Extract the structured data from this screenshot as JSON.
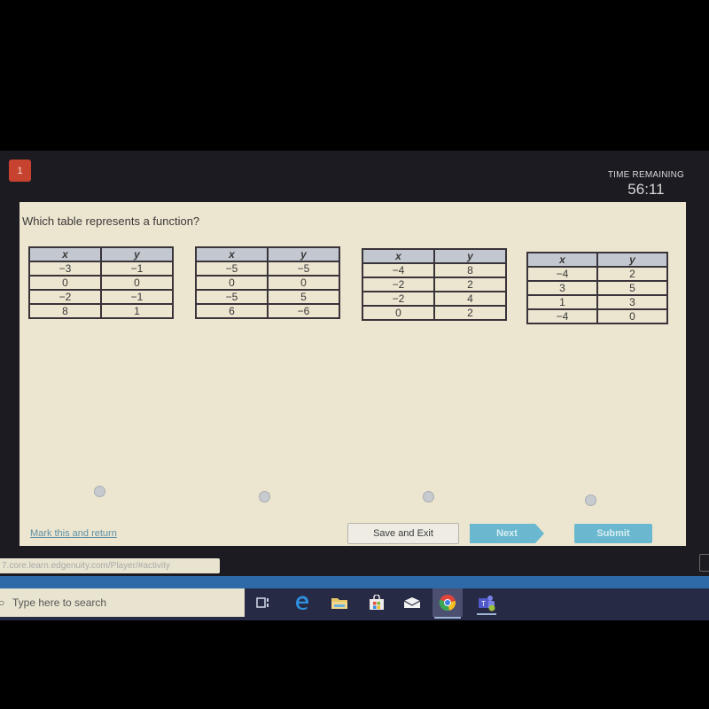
{
  "header": {
    "question_number": "1",
    "timer_label": "TIME REMAINING",
    "timer_value": "56:11"
  },
  "question": {
    "prompt": "Which table represents a function?",
    "options": [
      {
        "columns": [
          "x",
          "y"
        ],
        "rows": [
          [
            "−3",
            "−1"
          ],
          [
            "0",
            "0"
          ],
          [
            "−2",
            "−1"
          ],
          [
            "8",
            "1"
          ]
        ],
        "selected": false
      },
      {
        "columns": [
          "x",
          "y"
        ],
        "rows": [
          [
            "−5",
            "−5"
          ],
          [
            "0",
            "0"
          ],
          [
            "−5",
            "5"
          ],
          [
            "6",
            "−6"
          ]
        ],
        "selected": false
      },
      {
        "columns": [
          "x",
          "y"
        ],
        "rows": [
          [
            "−4",
            "8"
          ],
          [
            "−2",
            "2"
          ],
          [
            "−2",
            "4"
          ],
          [
            "0",
            "2"
          ]
        ],
        "selected": false
      },
      {
        "columns": [
          "x",
          "y"
        ],
        "rows": [
          [
            "−4",
            "2"
          ],
          [
            "3",
            "5"
          ],
          [
            "1",
            "3"
          ],
          [
            "−4",
            "0"
          ]
        ],
        "selected": false
      }
    ]
  },
  "footer": {
    "mark_link": "Mark this and return",
    "save_exit": "Save and Exit",
    "next": "Next",
    "submit": "Submit"
  },
  "browser": {
    "status_url": "7.core.learn.edgenuity.com/Player/#activity"
  },
  "taskbar": {
    "search_placeholder": "Type here to search",
    "icons": [
      "task-view-icon",
      "edge-icon",
      "file-explorer-icon",
      "store-icon",
      "mail-icon",
      "chrome-icon",
      "teams-icon"
    ],
    "active_icon": "chrome-icon"
  }
}
